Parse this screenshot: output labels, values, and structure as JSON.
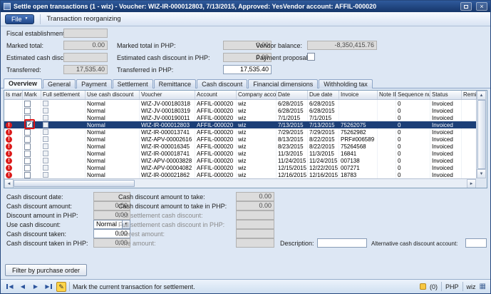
{
  "window": {
    "title": "Settle open transactions (1 - wiz) - Voucher: WIZ-IR-000012803, 7/13/2015, Approved: YesVendor account: AFFIL-000020",
    "close_glyph": "×"
  },
  "menubar": {
    "file_label": "File",
    "transaction_reorganizing_label": "Transaction reorganizing"
  },
  "header": {
    "fiscal_establishment_id": {
      "label": "Fiscal establishment ID:",
      "value": ""
    },
    "marked_total": {
      "label": "Marked total:",
      "value": "0.00"
    },
    "marked_total_php": {
      "label": "Marked total in PHP:",
      "value": "0.00"
    },
    "vendor_balance": {
      "label": "Vendor balance:",
      "value": "-8,350,415.76"
    },
    "estimated_cash_discount": {
      "label": "Estimated cash discount:",
      "value": ""
    },
    "estimated_cash_discount_php": {
      "label": "Estimated cash discount in PHP:",
      "value": "0.00"
    },
    "payment_proposal": {
      "label": "Payment proposal:",
      "checked": false
    },
    "transferred": {
      "label": "Transferred:",
      "value": "17,535.40"
    },
    "transferred_php": {
      "label": "Transferred in PHP:",
      "value": "17,535.40"
    }
  },
  "tabs": [
    {
      "label": "Overview",
      "active": true
    },
    {
      "label": "General",
      "active": false
    },
    {
      "label": "Payment",
      "active": false
    },
    {
      "label": "Settlement",
      "active": false
    },
    {
      "label": "Remittance",
      "active": false
    },
    {
      "label": "Cash discount",
      "active": false
    },
    {
      "label": "Financial dimensions",
      "active": false
    },
    {
      "label": "Withholding tax",
      "active": false
    }
  ],
  "grid": {
    "columns": [
      "Is marked",
      "Mark",
      "Full settlement",
      "Use cash discount",
      "Voucher",
      "Account",
      "Company accounts",
      "Date",
      "Due date",
      "Invoice",
      "Note ID",
      "Sequence number",
      "Status",
      "Remittance"
    ],
    "rows": [
      {
        "warning": false,
        "marked": false,
        "selected": false,
        "use_cash_discount": "Normal",
        "voucher": "WIZ-JV-000180318",
        "account": "AFFIL-000020",
        "company_accounts": "wiz",
        "date": "6/28/2015",
        "due_date": "6/28/2015",
        "invoice": "",
        "note_id": "",
        "sequence_number": "0",
        "status": "Invoiced",
        "remittance": ""
      },
      {
        "warning": false,
        "marked": false,
        "selected": false,
        "use_cash_discount": "Normal",
        "voucher": "WIZ-JV-000180319",
        "account": "AFFIL-000020",
        "company_accounts": "wiz",
        "date": "6/28/2015",
        "due_date": "6/28/2015",
        "invoice": "",
        "note_id": "",
        "sequence_number": "0",
        "status": "Invoiced",
        "remittance": ""
      },
      {
        "warning": false,
        "marked": false,
        "selected": false,
        "use_cash_discount": "Normal",
        "voucher": "WIZ-JV-000190011",
        "account": "AFFIL-000020",
        "company_accounts": "wiz",
        "date": "7/1/2015",
        "due_date": "7/1/2015",
        "invoice": "",
        "note_id": "",
        "sequence_number": "0",
        "status": "Invoiced",
        "remittance": ""
      },
      {
        "warning": true,
        "marked": true,
        "selected": true,
        "use_cash_discount": "Normal",
        "voucher": "WIZ-IR-000012803",
        "account": "AFFIL-000020",
        "company_accounts": "wiz",
        "date": "7/13/2015",
        "due_date": "7/13/2015",
        "invoice": "75262075",
        "note_id": "",
        "sequence_number": "0",
        "status": "Invoiced",
        "remittance": ""
      },
      {
        "warning": true,
        "marked": false,
        "selected": false,
        "use_cash_discount": "Normal",
        "voucher": "WIZ-IR-000013741",
        "account": "AFFIL-000020",
        "company_accounts": "wiz",
        "date": "7/29/2015",
        "due_date": "7/29/2015",
        "invoice": "75262982",
        "note_id": "",
        "sequence_number": "0",
        "status": "Invoiced",
        "remittance": ""
      },
      {
        "warning": true,
        "marked": false,
        "selected": false,
        "use_cash_discount": "Normal",
        "voucher": "WIZ-APV-00002616",
        "account": "AFFIL-000020",
        "company_accounts": "wiz",
        "date": "8/13/2015",
        "due_date": "8/22/2015",
        "invoice": "PRF#006589",
        "note_id": "",
        "sequence_number": "0",
        "status": "Invoiced",
        "remittance": ""
      },
      {
        "warning": true,
        "marked": false,
        "selected": false,
        "use_cash_discount": "Normal",
        "voucher": "WIZ-IR-000016345",
        "account": "AFFIL-000020",
        "company_accounts": "wiz",
        "date": "8/23/2015",
        "due_date": "8/22/2015",
        "invoice": "75264568",
        "note_id": "",
        "sequence_number": "0",
        "status": "Invoiced",
        "remittance": ""
      },
      {
        "warning": true,
        "marked": false,
        "selected": false,
        "use_cash_discount": "Normal",
        "voucher": "WIZ-IR-000018741",
        "account": "AFFIL-000020",
        "company_accounts": "wiz",
        "date": "11/3/2015",
        "due_date": "11/3/2015",
        "invoice": "16841",
        "note_id": "",
        "sequence_number": "0",
        "status": "Invoiced",
        "remittance": ""
      },
      {
        "warning": true,
        "marked": false,
        "selected": false,
        "use_cash_discount": "Normal",
        "voucher": "WIZ-APV-00003828",
        "account": "AFFIL-000020",
        "company_accounts": "wiz",
        "date": "11/24/2015",
        "due_date": "11/24/2015",
        "invoice": "007138",
        "note_id": "",
        "sequence_number": "0",
        "status": "Invoiced",
        "remittance": ""
      },
      {
        "warning": true,
        "marked": false,
        "selected": false,
        "use_cash_discount": "Normal",
        "voucher": "WIZ-APV-00004082",
        "account": "AFFIL-000020",
        "company_accounts": "wiz",
        "date": "12/15/2015",
        "due_date": "12/22/2015",
        "invoice": "007271",
        "note_id": "",
        "sequence_number": "0",
        "status": "Invoiced",
        "remittance": ""
      },
      {
        "warning": true,
        "marked": false,
        "selected": false,
        "use_cash_discount": "Normal",
        "voucher": "WIZ-IR-000021862",
        "account": "AFFIL-000020",
        "company_accounts": "wiz",
        "date": "12/16/2015",
        "due_date": "12/16/2015",
        "invoice": "18783",
        "note_id": "",
        "sequence_number": "0",
        "status": "Invoiced",
        "remittance": ""
      }
    ]
  },
  "details": {
    "cash_discount_date": {
      "label": "Cash discount date:",
      "value": ""
    },
    "cash_discount_amount": {
      "label": "Cash discount amount:",
      "value": "0.00"
    },
    "discount_amount_in_php": {
      "label": "Discount amount in PHP:",
      "value": "0.00"
    },
    "use_cash_discount": {
      "label": "Use cash discount:",
      "value": "Normal"
    },
    "cash_discount_taken": {
      "label": "Cash discount taken:",
      "value": "0.00"
    },
    "cash_discount_taken_in_php": {
      "label": "Cash discount taken in PHP:",
      "value": "0.00"
    },
    "cash_discount_amount_to_take": {
      "label": "Cash discount amount to take:",
      "value": "0.00"
    },
    "cash_discount_amount_to_take_in_php": {
      "label": "Cash discount amount to take in PHP:",
      "value": "0.00"
    },
    "full_settlement_cash_discount": {
      "label": "Full settlement cash discount:",
      "value": ""
    },
    "full_settlement_cash_discount_in_php": {
      "label": "Full settlement cash discount in PHP:",
      "value": ""
    },
    "interest_amount": {
      "label": "Interest amount:",
      "value": ""
    },
    "fine_amount": {
      "label": "Fine amount:",
      "value": ""
    },
    "description": {
      "label": "Description:",
      "value": ""
    },
    "alternative_cash_discount_account": {
      "label": "Alternative cash discount account:",
      "value": ""
    }
  },
  "filter_button_label": "Filter by purchase order",
  "statusbar": {
    "hint": "Mark the current transaction for settlement.",
    "notification_count": "(0)",
    "currency": "PHP",
    "company": "wiz"
  }
}
